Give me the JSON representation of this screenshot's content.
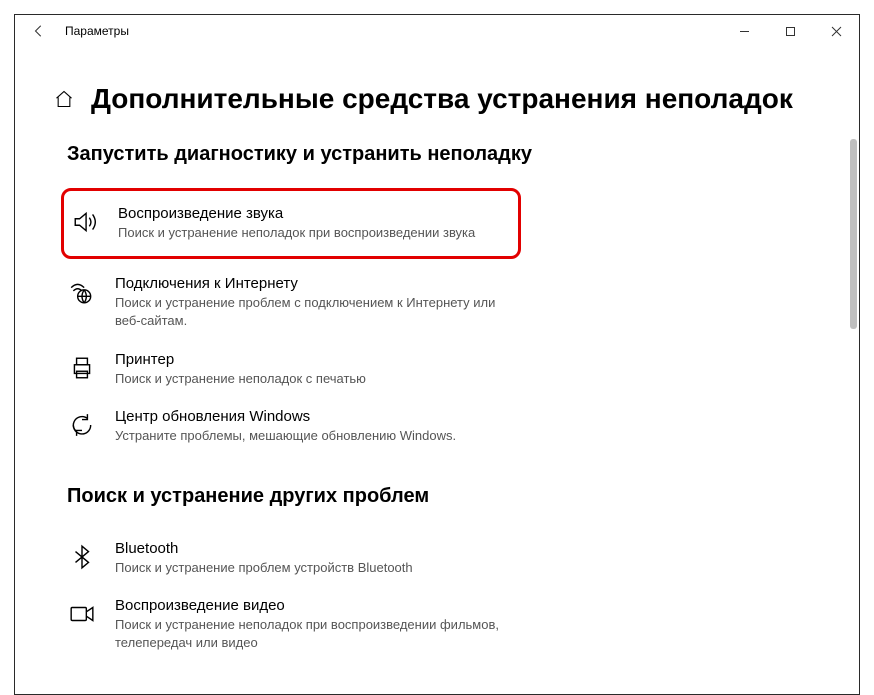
{
  "window": {
    "title": "Параметры"
  },
  "page": {
    "title": "Дополнительные средства устранения неполадок"
  },
  "sections": {
    "diagnose": {
      "heading": "Запустить диагностику и устранить неполадку",
      "items": {
        "audio": {
          "title": "Воспроизведение звука",
          "desc": "Поиск и устранение неполадок при воспроизведении звука"
        },
        "internet": {
          "title": "Подключения к Интернету",
          "desc": "Поиск и устранение проблем с подключением к Интернету или веб-сайтам."
        },
        "printer": {
          "title": "Принтер",
          "desc": "Поиск и устранение неполадок с печатью"
        },
        "update": {
          "title": "Центр обновления Windows",
          "desc": "Устраните проблемы, мешающие обновлению Windows."
        }
      }
    },
    "other": {
      "heading": "Поиск и устранение других проблем",
      "items": {
        "bluetooth": {
          "title": "Bluetooth",
          "desc": "Поиск и устранение проблем устройств Bluetooth"
        },
        "video": {
          "title": "Воспроизведение видео",
          "desc": "Поиск и устранение неполадок при воспроизведении фильмов, телепередач или видео"
        }
      }
    }
  }
}
